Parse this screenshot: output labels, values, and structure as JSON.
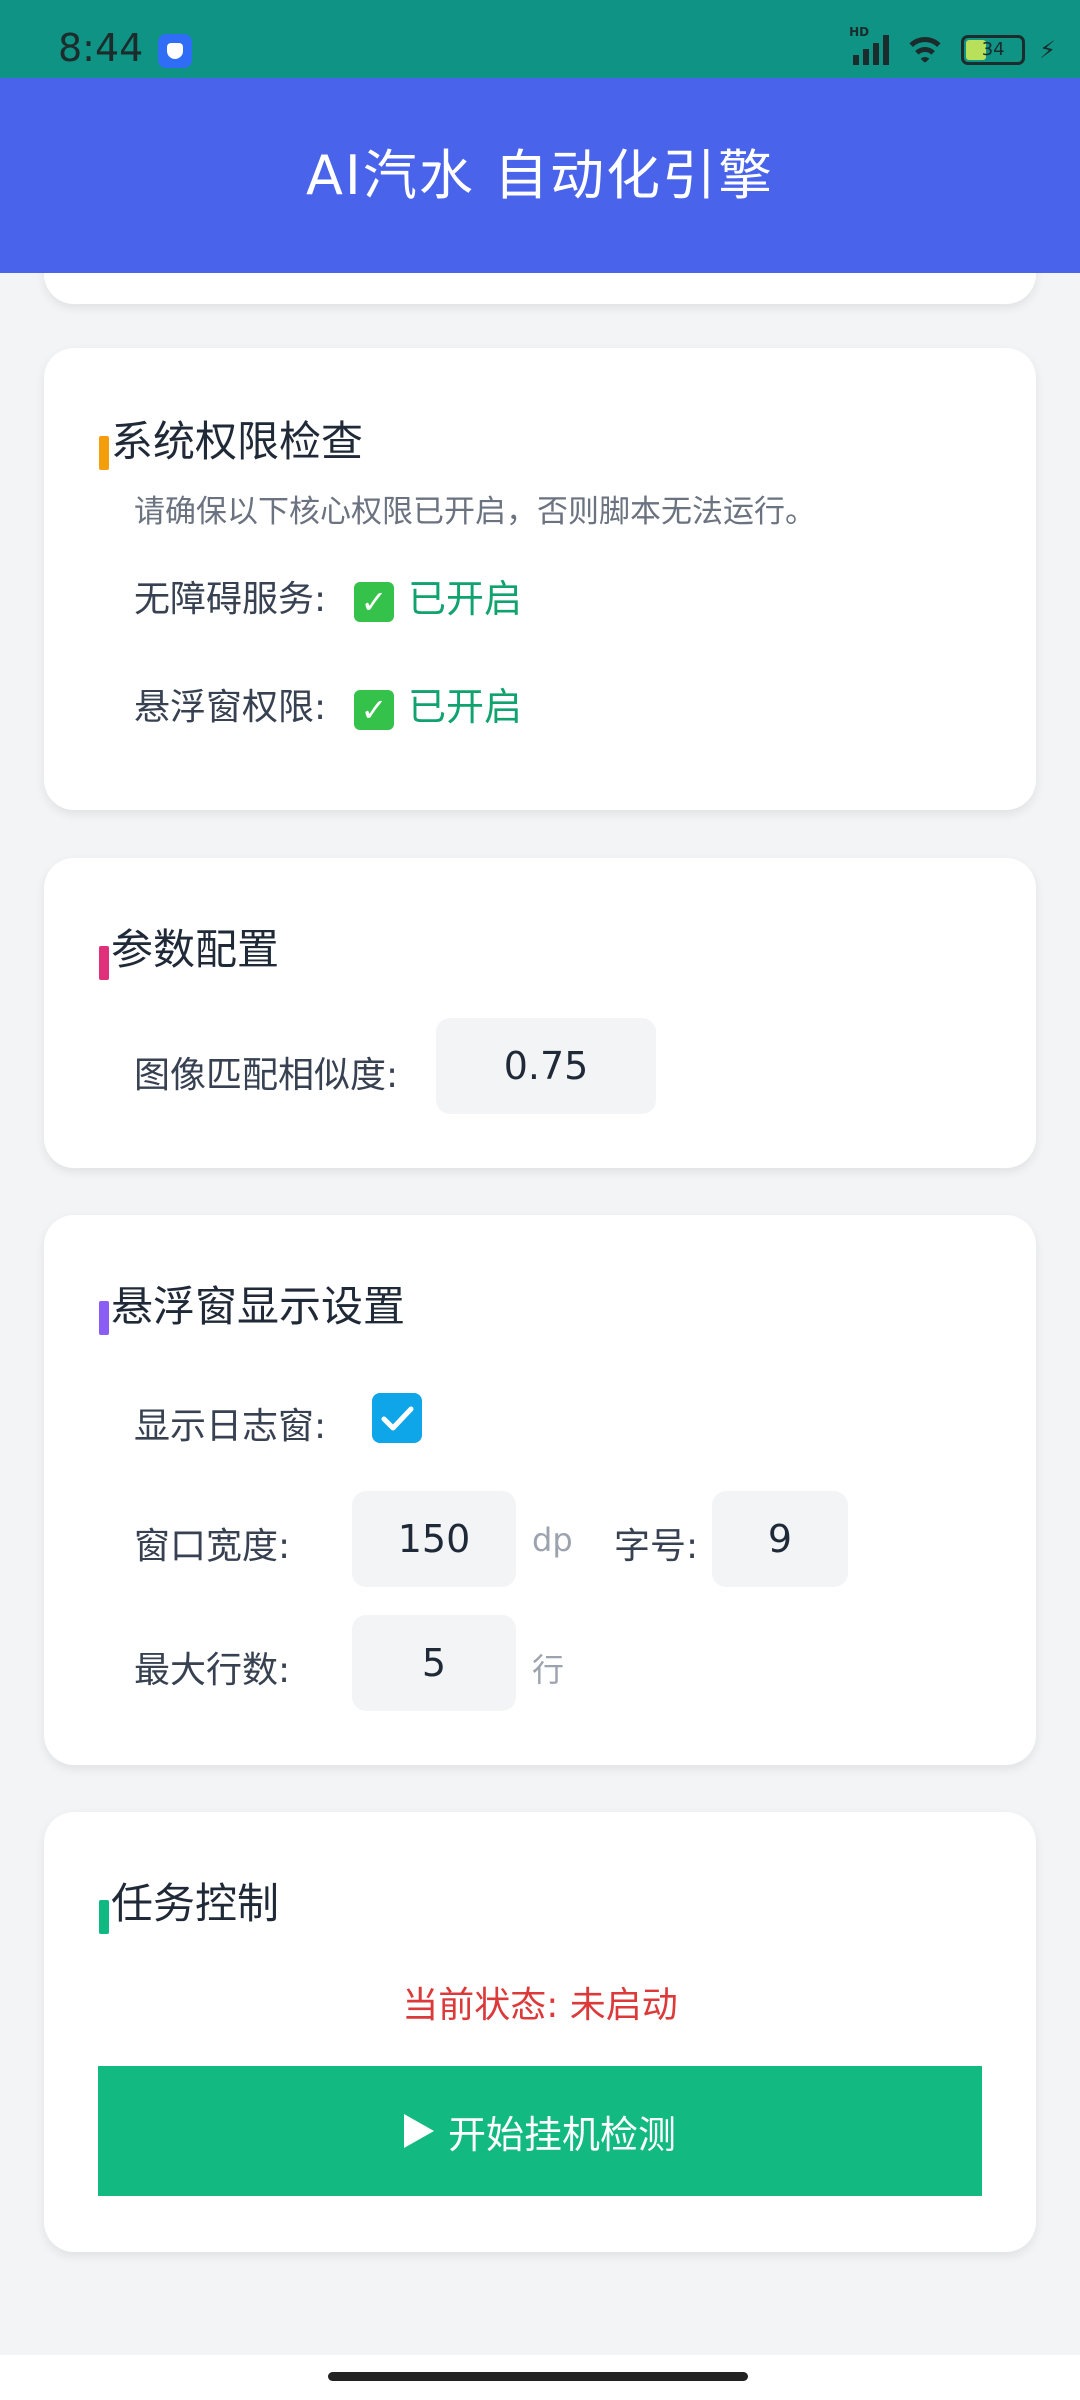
{
  "status_bar": {
    "time": "8:44",
    "network": "HD",
    "battery_level": "34",
    "icons": [
      "app-icon",
      "signal-icon",
      "wifi-icon",
      "battery-icon",
      "charging-icon"
    ]
  },
  "app_bar": {
    "title": "AI汽水 自动化引擎"
  },
  "permissions": {
    "title": "系统权限检查",
    "accent": "#f59e0b",
    "description": "请确保以下核心权限已开启，否则脚本无法运行。",
    "items": [
      {
        "label": "无障碍服务:",
        "status": "已开启"
      },
      {
        "label": "悬浮窗权限:",
        "status": "已开启"
      }
    ]
  },
  "params": {
    "title": "参数配置",
    "accent": "#e0307a",
    "similarity_label": "图像匹配相似度:",
    "similarity_value": "0.75"
  },
  "overlay": {
    "title": "悬浮窗显示设置",
    "accent": "#8b5cf6",
    "show_log_label": "显示日志窗:",
    "show_log_checked": true,
    "width_label": "窗口宽度:",
    "width_value": "150",
    "width_unit": "dp",
    "font_label": "字号:",
    "font_value": "9",
    "max_lines_label": "最大行数:",
    "max_lines_value": "5",
    "max_lines_unit": "行"
  },
  "task": {
    "title": "任务控制",
    "accent": "#10b981",
    "status_text": "当前状态: 未启动",
    "status_color": "#dc3a3a",
    "start_label": "开始挂机检测",
    "start_button_color": "#12b981"
  }
}
